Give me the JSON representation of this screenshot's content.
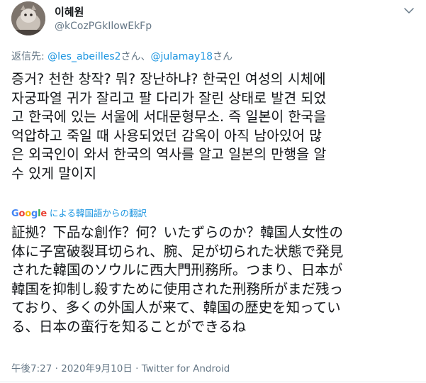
{
  "user": {
    "display_name": "이혜원",
    "handle": "@kCozPGkIlowEkFp"
  },
  "reply": {
    "prefix": "返信先: ",
    "mention1": "@les_abeilles2",
    "sep1": "さん、",
    "mention2": "@julamay18",
    "sep2": "さん"
  },
  "tweet": {
    "original_text": "증거? 천한 창작? 뭐? 장난하냐? 한국인 여성의 시체에\n자궁파열 귀가 잘리고 팔 다리가 잘린 상태로 발견 되었\n고 한국에 있는 서울에 서대문형무소. 즉 일본이 한국을\n억압하고 죽일 때 사용되었던 감옥이 아직 남아있어 많\n은 외국인이 와서 한국의 역사를 알고 일본의 만행을 알\n수 있게 말이지",
    "translated_text": "証拠？下品な創作？何？いたずらのか？韓国人女性の\n体に子宮破裂耳切られ、腕、足が切られた状態で発見\nされた韓国のソウルに西大門刑務所。つまり、日本が\n韓国を抑制し殺すために使用された刑務所がまだ残っ\nており、多くの外国人が来て、韓国の歴史を知ってい\nる、日本の蛮行を知ることができるね"
  },
  "translation": {
    "logo_parts": [
      "G",
      "o",
      "o",
      "g",
      "l",
      "e"
    ],
    "label": " による韓国語からの翻訳"
  },
  "meta": {
    "time": "午後7:27",
    "dot": " · ",
    "date": "2020年9月10日",
    "dot2": " · ",
    "source": "Twitter for Android"
  },
  "colors": {
    "link": "#1b95e0",
    "secondary": "#657786",
    "text": "#14171a"
  },
  "icons": {
    "menu": "chevron-down-icon",
    "avatar": "avatar"
  }
}
